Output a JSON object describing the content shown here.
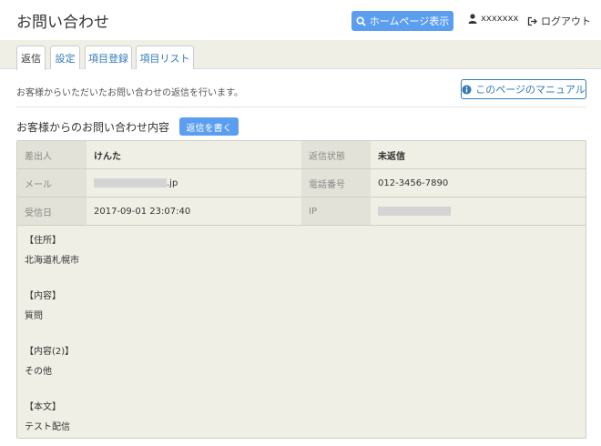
{
  "header": {
    "title": "お問い合わせ",
    "homepage_button": "ホームページ表示",
    "username": "xxxxxxx",
    "logout": "ログアウト"
  },
  "tabs": [
    {
      "label": "返信",
      "active": true
    },
    {
      "label": "設定",
      "active": false
    },
    {
      "label": "項目登録",
      "active": false
    },
    {
      "label": "項目リスト",
      "active": false
    }
  ],
  "info": {
    "description": "お客様からいただいたお問い合わせの返信を行います。",
    "manual_button": "このページのマニュアル"
  },
  "section": {
    "title": "お客様からのお問い合わせ内容",
    "reply_button": "返信を書く"
  },
  "details": {
    "sender_label": "差出人",
    "sender_value": "けんた",
    "status_label": "返信状態",
    "status_value": "未返信",
    "mail_label": "メール",
    "mail_suffix": ".jp",
    "phone_label": "電話番号",
    "phone_value": "012-3456-7890",
    "received_label": "受信日",
    "received_value": "2017-09-01 23:07:40",
    "ip_label": "IP"
  },
  "body": {
    "address_label": "【住所】",
    "address_value": "北海道札幌市",
    "content_label": "【内容】",
    "content_value": "質問",
    "content2_label": "【内容(2)】",
    "content2_value": "その他",
    "text_label": "【本文】",
    "text_value": "テスト配信"
  },
  "colors": {
    "primary": "#5b9ef0",
    "link": "#337ab7",
    "panel_bg": "#f0efe6"
  }
}
